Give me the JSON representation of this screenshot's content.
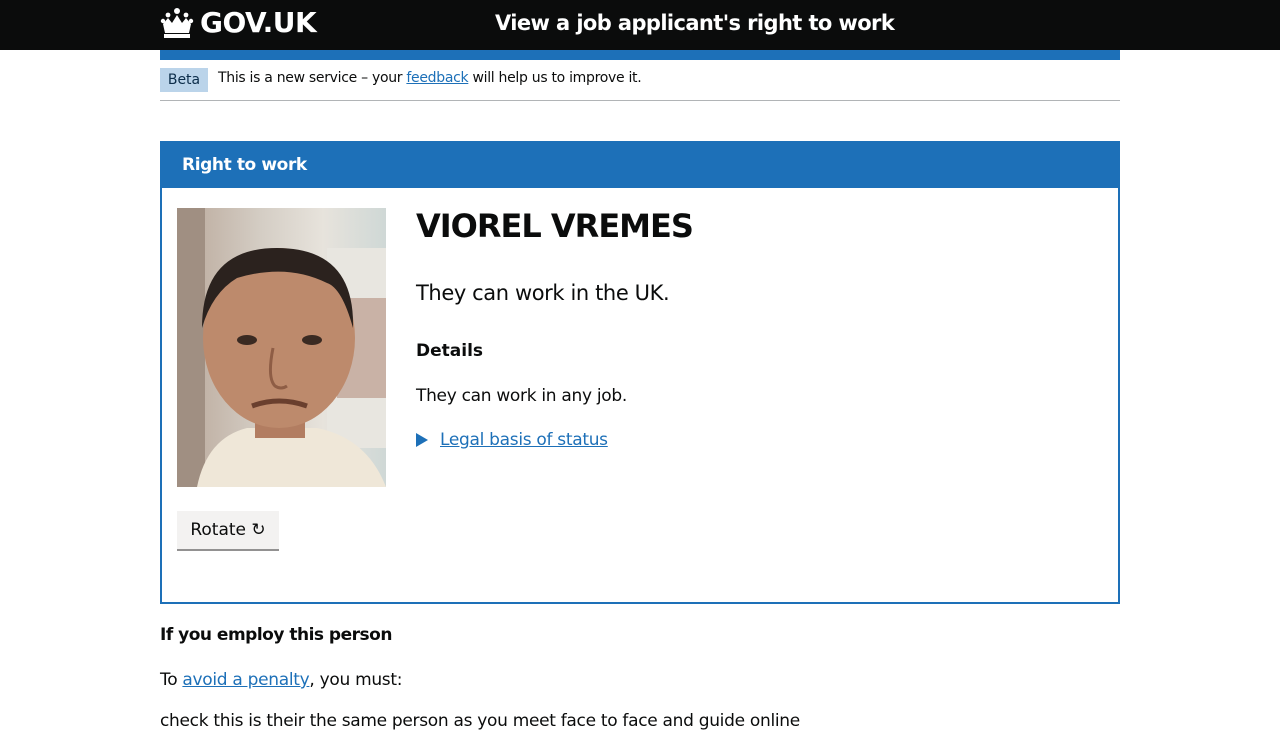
{
  "header": {
    "logo_text": "GOV.UK",
    "service_name": "View a job applicant's right to work"
  },
  "phase_banner": {
    "tag": "Beta",
    "text_before": "This is a new service – your ",
    "link_text": "feedback",
    "text_after": " will help us to improve it."
  },
  "panel": {
    "title": "Right to work",
    "person_name": "VIOREL VREMES",
    "status": "They can work in the UK.",
    "details_heading": "Details",
    "details_text": "They can work in any job.",
    "legal_link": "Legal basis of status",
    "rotate_label": "Rotate ↻"
  },
  "employ": {
    "heading": "If you employ this person",
    "text_before": "To ",
    "link_text": "avoid a penalty",
    "text_after": ", you must:",
    "next_line": "check this is their the same person as you meet face to face and guide online"
  },
  "colors": {
    "brand_blue": "#1d70b8",
    "header_black": "#0b0c0c",
    "beta_tag_bg": "#bbd4ea"
  }
}
